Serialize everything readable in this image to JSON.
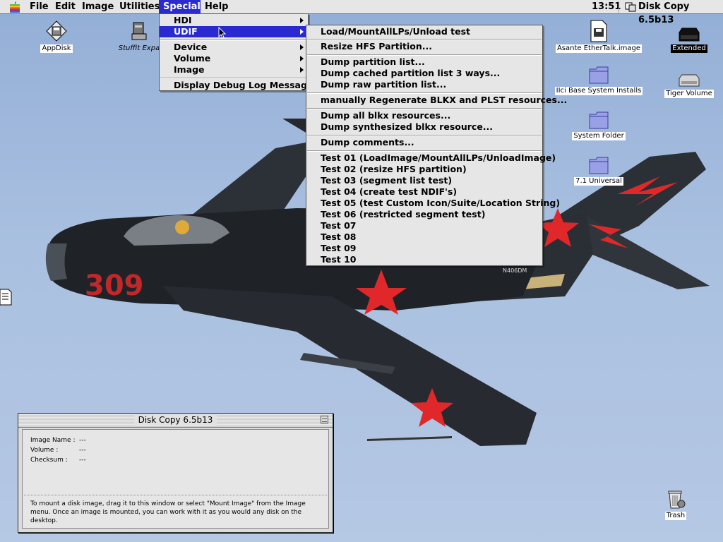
{
  "menubar": {
    "items": [
      "File",
      "Edit",
      "Image",
      "Utilities",
      "Special",
      "Help"
    ],
    "active": "Special",
    "clock": "13:51",
    "app_name": "Disk Copy 6.5b13"
  },
  "desktop_icons": {
    "appdisk": "AppDisk",
    "stuffit": "Stuffit Expa",
    "asante": "Asante EtherTalk.image",
    "extended": "Extended",
    "ilci": "IIci Base System Installs",
    "tiger": "Tiger Volume",
    "system_folder": "System Folder",
    "universal": "7.1 Universal",
    "trash": "Trash"
  },
  "special_menu": {
    "items": [
      "HDI",
      "UDIF",
      "Device",
      "Volume",
      "Image",
      "Display Debug Log Messages"
    ],
    "highlighted": "UDIF"
  },
  "udif_submenu": {
    "items": [
      "Load/MountAllLPs/Unload test",
      "Resize HFS Partition...",
      "Dump partition list...",
      "Dump cached partition list 3 ways...",
      "Dump raw partition list...",
      "manually Regenerate BLKX and PLST resources...",
      "Dump all blkx resources...",
      "Dump synthesized blkx resource...",
      "Dump comments...",
      "Test 01 (LoadImage/MountAllLPs/UnloadImage)",
      "Test 02 (resize HFS partition)",
      "Test 03 (segment list test)",
      "Test 04 (create test NDIF's)",
      "Test 05 (test Custom Icon/Suite/Location String)",
      "Test 06 (restricted segment test)",
      "Test 07",
      "Test 08",
      "Test 09",
      "Test 10"
    ]
  },
  "disk_copy_window": {
    "title": "Disk Copy 6.5b13",
    "image_name_label": "Image Name :",
    "image_name_value": "---",
    "volume_label": "Volume :",
    "volume_value": "---",
    "checksum_label": "Checksum :",
    "checksum_value": "---",
    "help_text": "To mount a disk image, drag it to this window or select \"Mount Image\" from the Image menu. Once an image is mounted, you can work with it as you would any disk on the desktop."
  },
  "plane": {
    "tail_number": "309",
    "registration": "N406DM"
  },
  "colors": {
    "highlight": "#2a2ad0",
    "menu_bg": "#e6e6e6",
    "sky": "#a9c0e0",
    "star_red": "#e0282a"
  }
}
